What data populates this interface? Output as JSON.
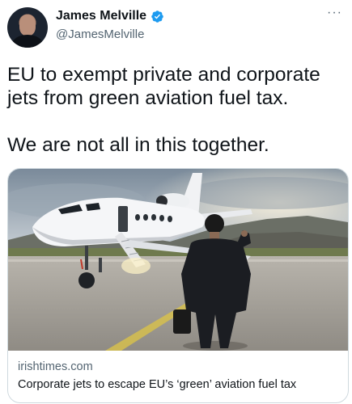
{
  "author": {
    "display_name": "James Melville",
    "handle": "@JamesMelville"
  },
  "tweet": {
    "line1": "EU to exempt private and corporate jets from green aviation fuel tax.",
    "line2": "We are not all in this together."
  },
  "card": {
    "domain": "irishtimes.com",
    "title": "Corporate jets to escape EU’s ‘green’ aviation fuel tax"
  },
  "more_glyph": "···",
  "colors": {
    "verified": "#1d9bf0",
    "secondary_text": "#536471",
    "primary_text": "#0f1419",
    "card_border": "#cfd9de"
  }
}
